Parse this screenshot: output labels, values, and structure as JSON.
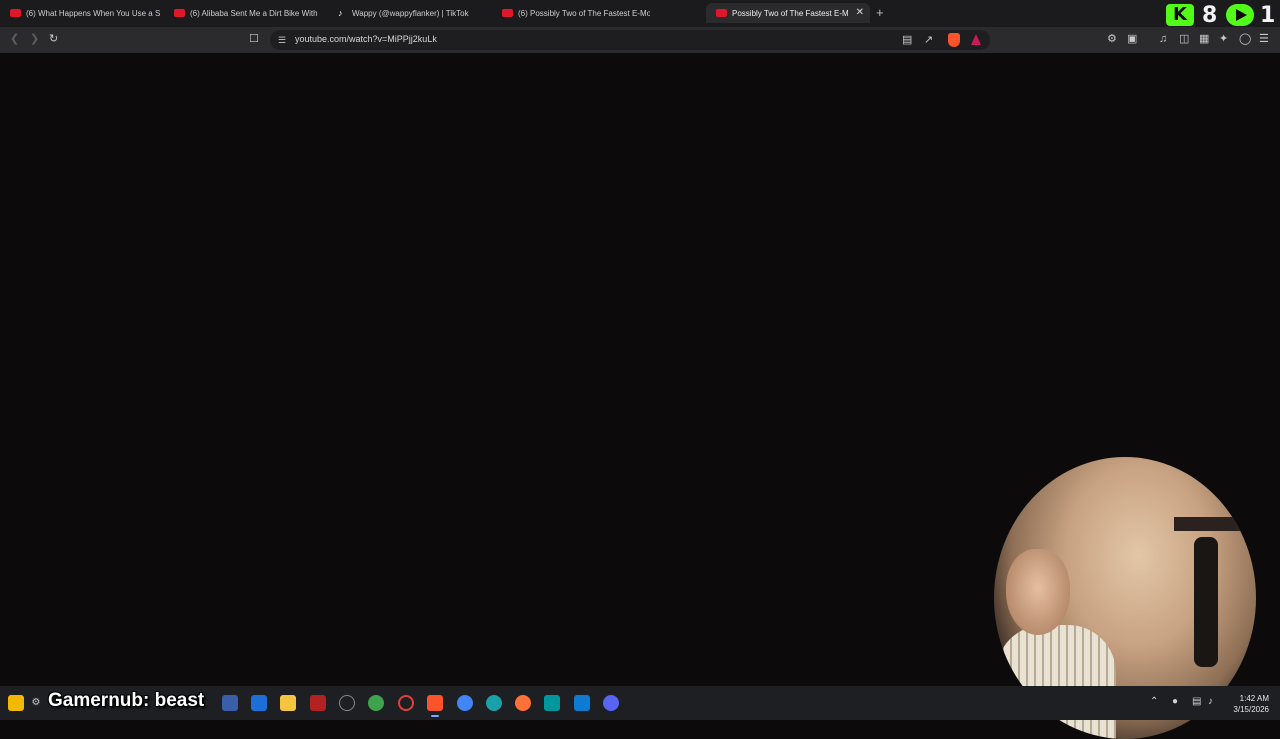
{
  "browser": {
    "tabs": [
      {
        "label": "(6) What Happens When You Use a S",
        "icon": "youtube-icon"
      },
      {
        "label": "(6) Alibaba Sent Me a Dirt Bike With",
        "icon": "youtube-icon"
      },
      {
        "label": "Wappy (@wappyflanker) | TikTok",
        "icon": "tiktok-icon"
      },
      {
        "label": "(6) Possibly Two of The Fastest E-Mo",
        "icon": "youtube-icon"
      },
      {
        "label": "Possibly Two of The Fastest E-Mo",
        "icon": "youtube-icon",
        "active": true
      }
    ],
    "close_glyph": "✕",
    "newtab_glyph": "+",
    "url": "youtube.com/watch?v=MiPPjj2kuLk"
  },
  "stream_overlay": {
    "kick_glyph": "K",
    "count": "8",
    "right_num": "1",
    "chat_message": "Gamernub: beast",
    "accent": "#53fc18"
  },
  "taskbar": {
    "time": "1:42 AM",
    "date": "3/15/2026"
  }
}
